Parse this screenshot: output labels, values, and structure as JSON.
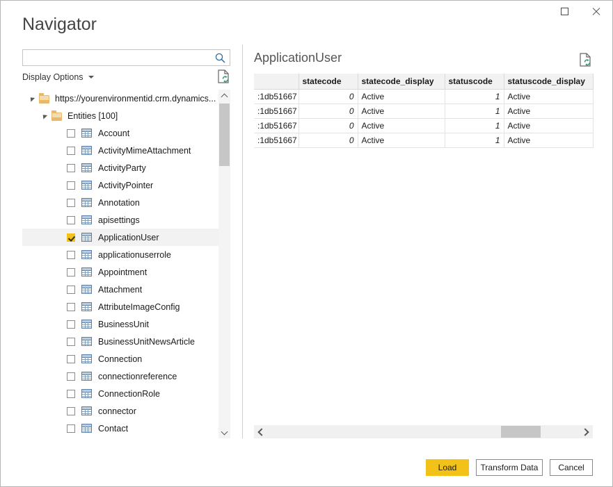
{
  "window": {
    "title": "Navigator",
    "controls": [
      {
        "name": "maximize",
        "label": "Maximize"
      },
      {
        "name": "close",
        "label": "Close"
      }
    ]
  },
  "left_pane": {
    "search": {
      "value": "",
      "placeholder": "",
      "icon": "search-icon"
    },
    "display_options": {
      "label": "Display Options",
      "caret": "chevron-down-icon"
    },
    "refresh_icon": "refresh-document-icon",
    "tree": {
      "root": {
        "label": "https://yourenvironmentid.crm.dynamics...",
        "expanded": true,
        "icon": "folder-icon"
      },
      "group": {
        "label": "Entities [100]",
        "expanded": true,
        "icon": "folder-icon"
      },
      "items": [
        {
          "label": "Account",
          "checked": false,
          "selected": false
        },
        {
          "label": "ActivityMimeAttachment",
          "checked": false,
          "selected": false
        },
        {
          "label": "ActivityParty",
          "checked": false,
          "selected": false
        },
        {
          "label": "ActivityPointer",
          "checked": false,
          "selected": false
        },
        {
          "label": "Annotation",
          "checked": false,
          "selected": false
        },
        {
          "label": "apisettings",
          "checked": false,
          "selected": false
        },
        {
          "label": "ApplicationUser",
          "checked": true,
          "selected": true
        },
        {
          "label": "applicationuserrole",
          "checked": false,
          "selected": false
        },
        {
          "label": "Appointment",
          "checked": false,
          "selected": false
        },
        {
          "label": "Attachment",
          "checked": false,
          "selected": false
        },
        {
          "label": "AttributeImageConfig",
          "checked": false,
          "selected": false
        },
        {
          "label": "BusinessUnit",
          "checked": false,
          "selected": false
        },
        {
          "label": "BusinessUnitNewsArticle",
          "checked": false,
          "selected": false
        },
        {
          "label": "Connection",
          "checked": false,
          "selected": false
        },
        {
          "label": "connectionreference",
          "checked": false,
          "selected": false
        },
        {
          "label": "ConnectionRole",
          "checked": false,
          "selected": false
        },
        {
          "label": "connector",
          "checked": false,
          "selected": false
        },
        {
          "label": "Contact",
          "checked": false,
          "selected": false
        }
      ]
    },
    "scrollbar": {
      "up_icon": "chevron-up-icon",
      "down_icon": "chevron-down-icon"
    }
  },
  "right_pane": {
    "title": "ApplicationUser",
    "refresh_icon": "refresh-document-icon",
    "table": {
      "columns": [
        "",
        "statecode",
        "statecode_display",
        "statuscode",
        "statuscode_display"
      ],
      "rows": [
        [
          ":1db51667",
          "0",
          "Active",
          "1",
          "Active"
        ],
        [
          ":1db51667",
          "0",
          "Active",
          "1",
          "Active"
        ],
        [
          ":1db51667",
          "0",
          "Active",
          "1",
          "Active"
        ],
        [
          ":1db51667",
          "0",
          "Active",
          "1",
          "Active"
        ]
      ]
    },
    "hscrollbar": {
      "left_icon": "chevron-left-icon",
      "right_icon": "chevron-right-icon"
    }
  },
  "footer": {
    "load_label": "Load",
    "transform_label": "Transform Data",
    "cancel_label": "Cancel"
  },
  "colors": {
    "accent": "#f2c218",
    "folder": "#e8b96a",
    "selection": "#f2f2f2",
    "scroll_thumb": "#c6c6c6",
    "header_bg": "#f2f2f2"
  }
}
